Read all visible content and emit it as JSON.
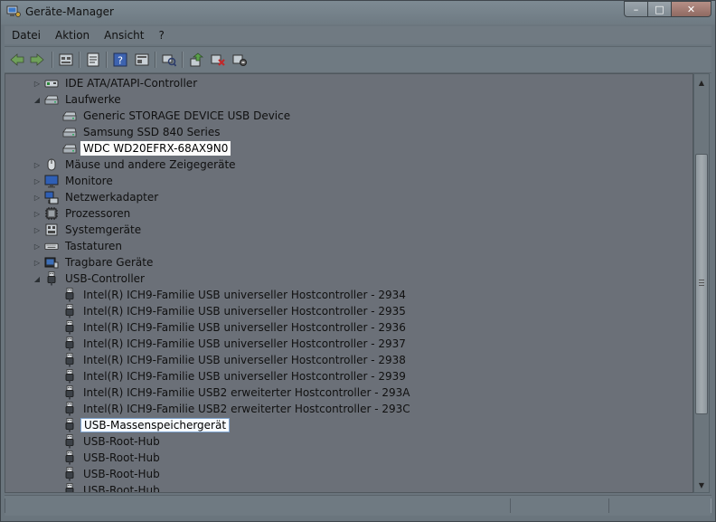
{
  "window": {
    "title": "Geräte-Manager",
    "controls": {
      "minimize": "–",
      "maximize": "□",
      "close": "✕"
    }
  },
  "menu": [
    "Datei",
    "Aktion",
    "Ansicht",
    "?"
  ],
  "toolbar": {
    "buttons": [
      "back-icon",
      "forward-icon",
      "computer-view-icon",
      "properties-icon",
      "help-icon",
      "details-icon",
      "scan-hardware-icon",
      "update-driver-icon",
      "uninstall-icon",
      "disable-icon"
    ]
  },
  "tree": {
    "rows": [
      {
        "label": "IDE ATA/ATAPI-Controller",
        "level": 1,
        "expander": "collapsed",
        "icon": "ide-controller-icon"
      },
      {
        "label": "Laufwerke",
        "level": 1,
        "expander": "expanded",
        "icon": "disk-drive-icon"
      },
      {
        "label": "Generic STORAGE DEVICE USB Device",
        "level": 2,
        "expander": "none",
        "icon": "disk-drive-icon"
      },
      {
        "label": "Samsung SSD 840 Series",
        "level": 2,
        "expander": "none",
        "icon": "disk-drive-icon"
      },
      {
        "label": "WDC WD20EFRX-68AX9N0",
        "level": 2,
        "expander": "none",
        "icon": "disk-drive-icon",
        "highlight": "white"
      },
      {
        "label": "Mäuse und andere Zeigegeräte",
        "level": 1,
        "expander": "collapsed",
        "icon": "mouse-icon"
      },
      {
        "label": "Monitore",
        "level": 1,
        "expander": "collapsed",
        "icon": "monitor-icon"
      },
      {
        "label": "Netzwerkadapter",
        "level": 1,
        "expander": "collapsed",
        "icon": "network-adapter-icon"
      },
      {
        "label": "Prozessoren",
        "level": 1,
        "expander": "collapsed",
        "icon": "processor-icon"
      },
      {
        "label": "Systemgeräte",
        "level": 1,
        "expander": "collapsed",
        "icon": "system-device-icon"
      },
      {
        "label": "Tastaturen",
        "level": 1,
        "expander": "collapsed",
        "icon": "keyboard-icon"
      },
      {
        "label": "Tragbare Geräte",
        "level": 1,
        "expander": "collapsed",
        "icon": "portable-device-icon"
      },
      {
        "label": "USB-Controller",
        "level": 1,
        "expander": "expanded",
        "icon": "usb-icon"
      },
      {
        "label": "Intel(R) ICH9-Familie USB universeller Hostcontroller - 2934",
        "level": 2,
        "expander": "none",
        "icon": "usb-icon"
      },
      {
        "label": "Intel(R) ICH9-Familie USB universeller Hostcontroller - 2935",
        "level": 2,
        "expander": "none",
        "icon": "usb-icon"
      },
      {
        "label": "Intel(R) ICH9-Familie USB universeller Hostcontroller - 2936",
        "level": 2,
        "expander": "none",
        "icon": "usb-icon"
      },
      {
        "label": "Intel(R) ICH9-Familie USB universeller Hostcontroller - 2937",
        "level": 2,
        "expander": "none",
        "icon": "usb-icon"
      },
      {
        "label": "Intel(R) ICH9-Familie USB universeller Hostcontroller - 2938",
        "level": 2,
        "expander": "none",
        "icon": "usb-icon"
      },
      {
        "label": "Intel(R) ICH9-Familie USB universeller Hostcontroller - 2939",
        "level": 2,
        "expander": "none",
        "icon": "usb-icon"
      },
      {
        "label": "Intel(R) ICH9-Familie USB2 erweiterter Hostcontroller - 293A",
        "level": 2,
        "expander": "none",
        "icon": "usb-icon"
      },
      {
        "label": "Intel(R) ICH9-Familie USB2 erweiterter Hostcontroller - 293C",
        "level": 2,
        "expander": "none",
        "icon": "usb-icon"
      },
      {
        "label": "USB-Massenspeichergerät",
        "level": 2,
        "expander": "none",
        "icon": "usb-icon",
        "highlight": "selected"
      },
      {
        "label": "USB-Root-Hub",
        "level": 2,
        "expander": "none",
        "icon": "usb-icon"
      },
      {
        "label": "USB-Root-Hub",
        "level": 2,
        "expander": "none",
        "icon": "usb-icon"
      },
      {
        "label": "USB-Root-Hub",
        "level": 2,
        "expander": "none",
        "icon": "usb-icon"
      },
      {
        "label": "USB-Root-Hub",
        "level": 2,
        "expander": "none",
        "icon": "usb-icon"
      }
    ]
  },
  "status": [
    "",
    "",
    ""
  ]
}
